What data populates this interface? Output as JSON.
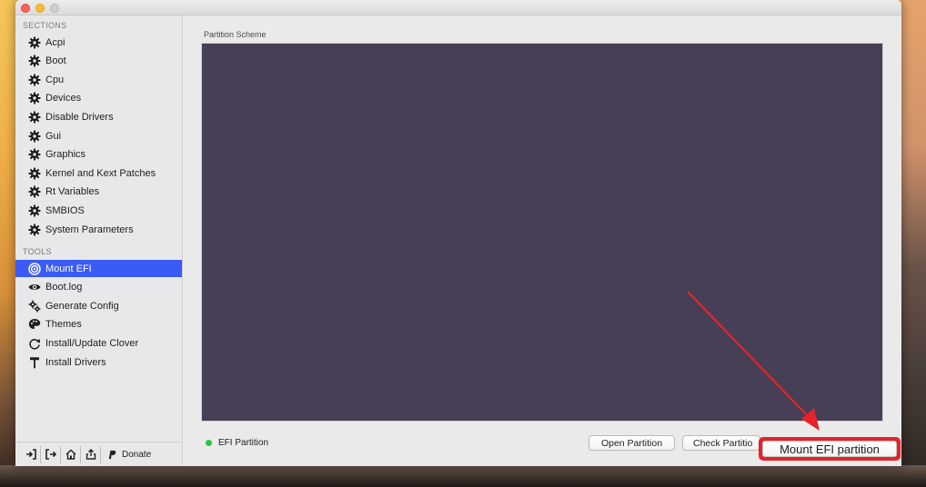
{
  "window": {
    "traffic_lights": [
      "close",
      "minimize",
      "zoom"
    ]
  },
  "sidebar": {
    "sections_header": "SECTIONS",
    "sections": [
      {
        "label": "Acpi",
        "icon": "gear-icon"
      },
      {
        "label": "Boot",
        "icon": "gear-icon"
      },
      {
        "label": "Cpu",
        "icon": "gear-icon"
      },
      {
        "label": "Devices",
        "icon": "gear-icon"
      },
      {
        "label": "Disable Drivers",
        "icon": "gear-icon"
      },
      {
        "label": "Gui",
        "icon": "gear-icon"
      },
      {
        "label": "Graphics",
        "icon": "gear-icon"
      },
      {
        "label": "Kernel and Kext Patches",
        "icon": "gear-icon"
      },
      {
        "label": "Rt Variables",
        "icon": "gear-icon"
      },
      {
        "label": "SMBIOS",
        "icon": "gear-icon"
      },
      {
        "label": "System Parameters",
        "icon": "gear-icon"
      }
    ],
    "tools_header": "TOOLS",
    "tools": [
      {
        "label": "Mount EFI",
        "icon": "target-icon",
        "selected": true
      },
      {
        "label": "Boot.log",
        "icon": "eye-icon"
      },
      {
        "label": "Generate Config",
        "icon": "gears-icon"
      },
      {
        "label": "Themes",
        "icon": "palette-icon"
      },
      {
        "label": "Install/Update Clover",
        "icon": "refresh-icon"
      },
      {
        "label": "Install Drivers",
        "icon": "hammer-icon"
      }
    ],
    "footer": {
      "buttons": [
        "import-icon",
        "export-icon",
        "home-icon",
        "share-icon"
      ],
      "donate_label": "Donate"
    }
  },
  "main": {
    "panel_label": "Partition Scheme",
    "status_label": "EFI Partition",
    "status_color": "#27c93f",
    "open_button": "Open Partition",
    "check_button": "Check Partitio",
    "mount_button": "Mount EFI partition"
  },
  "colors": {
    "selection": "#3a5bf5",
    "partition_area": "#463f55",
    "annotation": "#e5232a"
  }
}
